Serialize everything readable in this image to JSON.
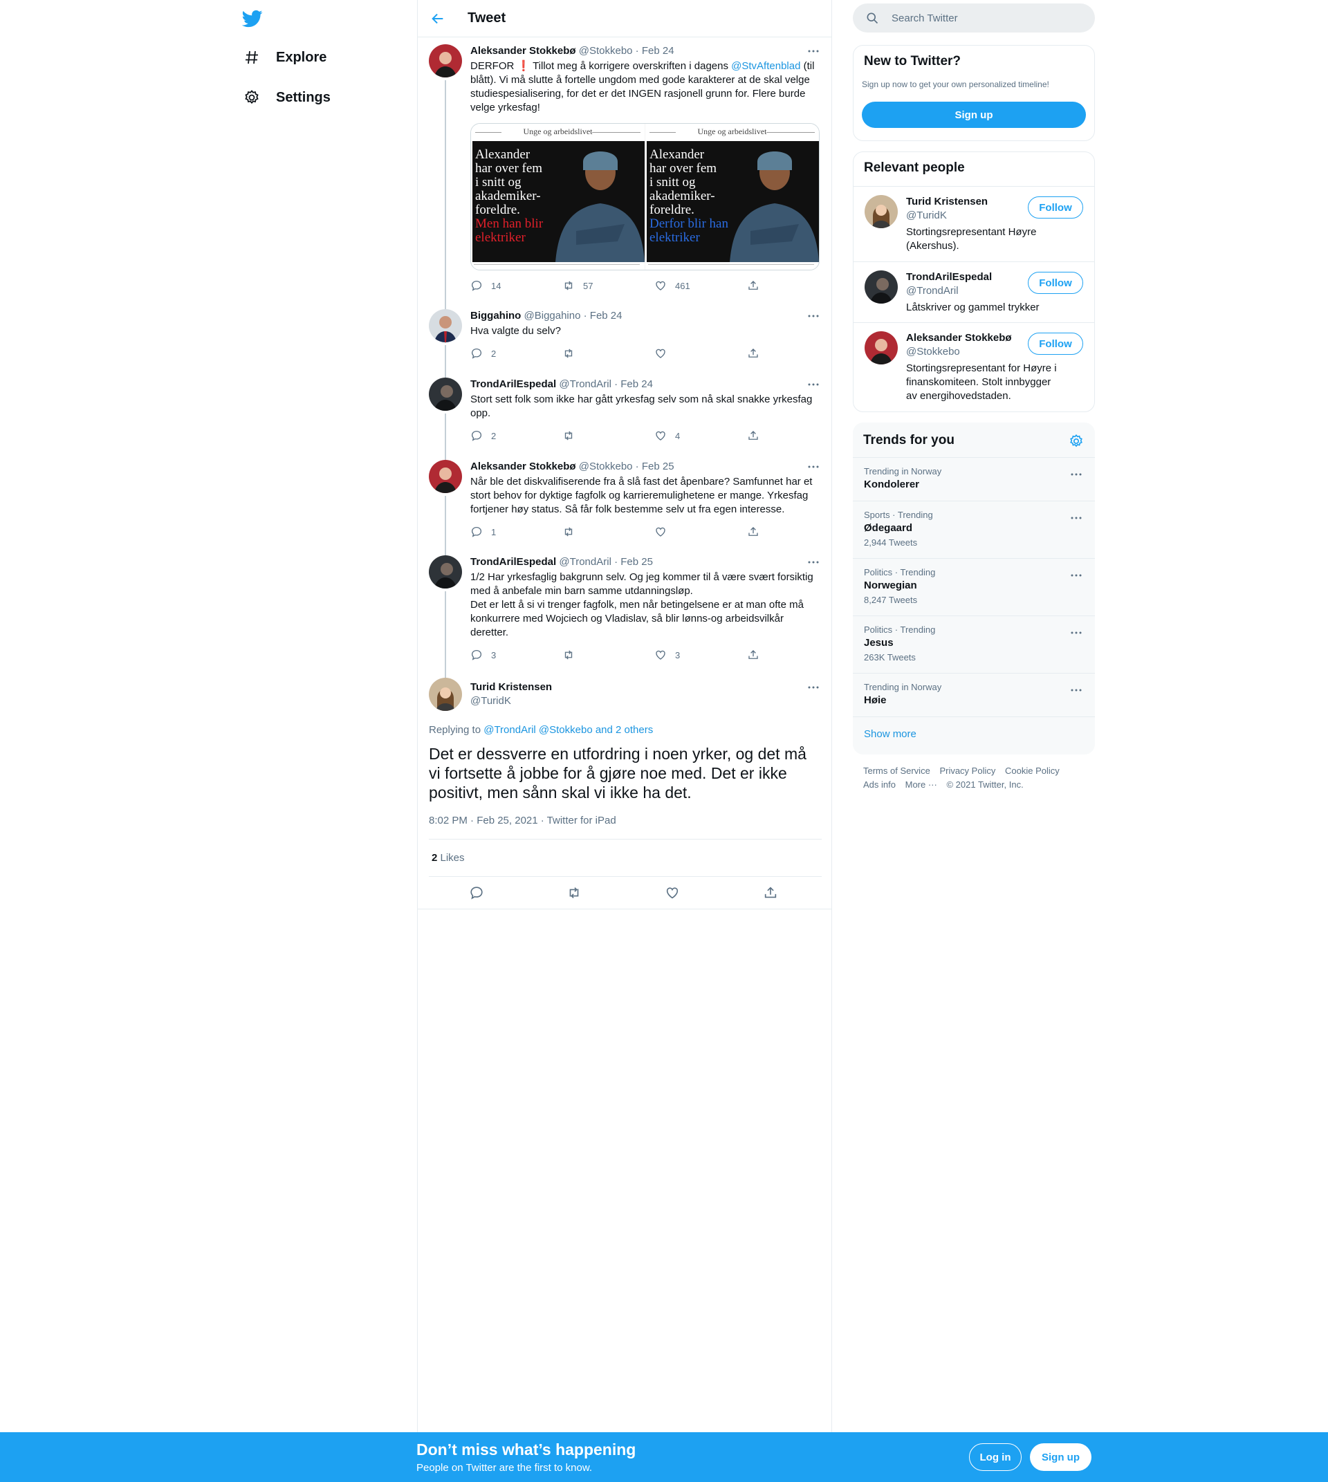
{
  "nav": {
    "explore_label": "Explore",
    "settings_label": "Settings"
  },
  "header": {
    "title": "Tweet"
  },
  "thread": [
    {
      "name": "Aleksander Stokkebø",
      "meta": "@Stokkebo · Feb 24",
      "text_before_link": "DERFOR ❗ Tillot meg å korrigere overskriften i dagens ",
      "link": "@StvAftenblad",
      "text_after_link": " (til blått). Vi må slutte å fortelle ungdom med gode karakterer at de skal velge studiespesialisering, for det er det INGEN rasjonell grunn for. Flere burde velge yrkesfag!",
      "media": {
        "left_caption": "Unge og arbeidslivet",
        "right_caption": "Unge og arbeidslivet",
        "headline_lines": [
          "Alexander",
          "har over fem",
          "i snitt og",
          "akademiker-",
          "foreldre."
        ],
        "left_sub_lines": [
          "Men han blir",
          "elektriker"
        ],
        "right_sub_lines": [
          "Derfor blir han",
          "elektriker"
        ],
        "left_sub_color": "#e0202a",
        "right_sub_color": "#2a6be0"
      },
      "replies": "14",
      "retweets": "57",
      "likes": "461"
    },
    {
      "name": "Biggahino",
      "meta": "@Biggahino · Feb 24",
      "text": "Hva valgte du selv?",
      "replies": "2",
      "retweets": "",
      "likes": ""
    },
    {
      "name": "TrondArilEspedal",
      "meta": "@TrondAril · Feb 24",
      "text": "Stort sett folk som ikke har gått yrkesfag selv som nå skal snakke yrkesfag opp.",
      "replies": "2",
      "retweets": "",
      "likes": "4"
    },
    {
      "name": "Aleksander Stokkebø",
      "meta": "@Stokkebo · Feb 25",
      "text": "Når ble det diskvalifiserende fra å slå fast det åpenbare? Samfunnet har et stort behov for dyktige fagfolk og karrieremulighetene er mange. Yrkesfag fortjener høy status. Så får folk bestemme selv ut fra egen interesse.",
      "replies": "1",
      "retweets": "",
      "likes": ""
    },
    {
      "name": "TrondArilEspedal",
      "meta": "@TrondAril · Feb 25",
      "text_line1": "1/2 Har yrkesfaglig bakgrunn selv. Og jeg kommer til å være svært forsiktig med å anbefale min barn samme utdanningsløp.",
      "text_line2": "Det er lett å si vi trenger fagfolk, men når betingelsene er at man ofte må konkurrere med Wojciech og Vladislav, så blir lønns-og arbeidsvilkår deretter.",
      "replies": "3",
      "retweets": "",
      "likes": "3"
    }
  ],
  "main_tweet": {
    "name": "Turid Kristensen",
    "handle": "@TuridK",
    "replying_prefix": "Replying to ",
    "replying_to": "@TrondAril @Stokkebo and 2 others",
    "text": "Det er dessverre en utfordring i noen yrker, og det må vi fortsette å jobbe for å gjøre noe med. Det er ikke positivt, men sånn skal vi ikke ha det.",
    "timestamp": "8:02 PM · Feb 25, 2021 · Twitter for iPad",
    "likes_count": "2",
    "likes_label": " Likes"
  },
  "search": {
    "placeholder": "Search Twitter"
  },
  "new_to_twitter": {
    "title": "New to Twitter?",
    "subtitle": "Sign up now to get your own personalized timeline!",
    "button": "Sign up"
  },
  "relevant_people": {
    "title": "Relevant people",
    "follow_label": "Follow",
    "people": [
      {
        "name": "Turid Kristensen",
        "handle": "@TuridK",
        "bio": "Stortingsrepresentant Høyre (Akershus)."
      },
      {
        "name": "TrondArilEspedal",
        "handle": "@TrondAril",
        "bio": "Låtskriver og gammel trykker"
      },
      {
        "name": "Aleksander Stokkebø",
        "handle": "@Stokkebo",
        "bio": "Stortingsrepresentant for Høyre i finanskomiteen. Stolt innbygger av energihovedstaden."
      }
    ]
  },
  "trends": {
    "title": "Trends for you",
    "items": [
      {
        "context": "Trending in Norway",
        "name": "Kondolerer",
        "count": ""
      },
      {
        "context": "Sports · Trending",
        "name": "Ødegaard",
        "count": "2,944 Tweets"
      },
      {
        "context": "Politics · Trending",
        "name": "Norwegian",
        "count": "8,247 Tweets"
      },
      {
        "context": "Politics · Trending",
        "name": "Jesus",
        "count": "263K Tweets"
      },
      {
        "context": "Trending in Norway",
        "name": "Høie",
        "count": ""
      }
    ],
    "show_more": "Show more"
  },
  "footer": {
    "terms": "Terms of Service",
    "privacy": "Privacy Policy",
    "cookie": "Cookie Policy",
    "ads": "Ads info",
    "more": "More ···",
    "copyright": "© 2021 Twitter, Inc."
  },
  "bottom_bar": {
    "title": "Don’t miss what’s happening",
    "subtitle": "People on Twitter are the first to know.",
    "login": "Log in",
    "signup": "Sign up"
  },
  "colors": {
    "accent": "#1da1f2",
    "link": "#1b95e0",
    "secondary_text": "#5b7083"
  }
}
